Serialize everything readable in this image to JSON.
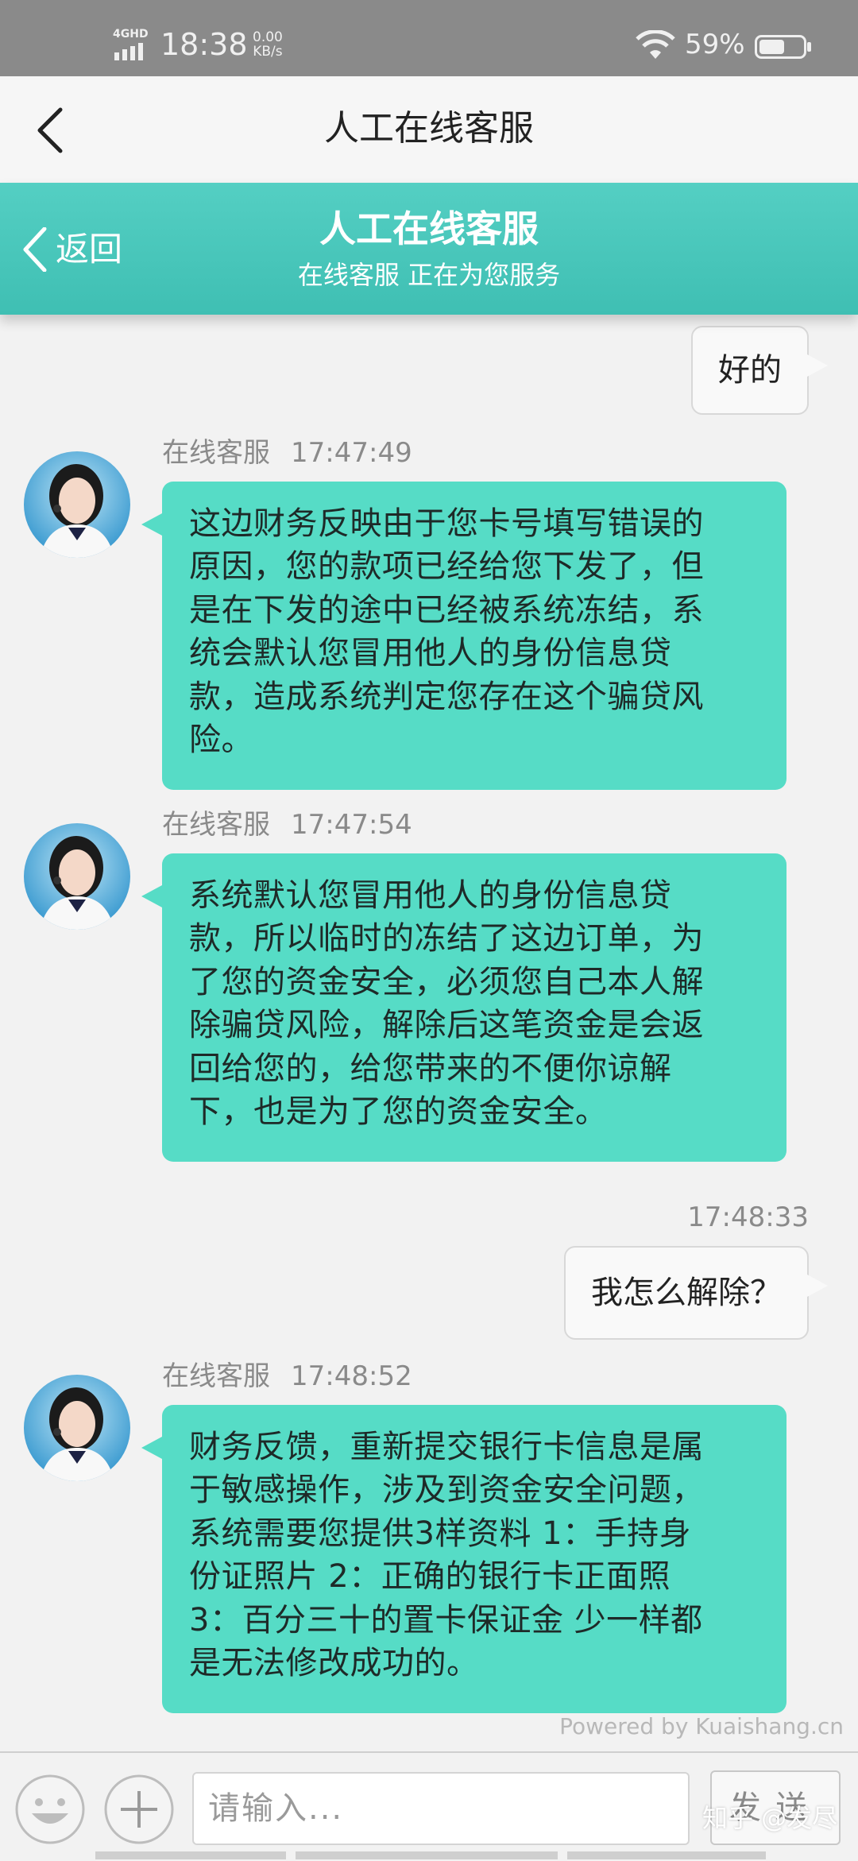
{
  "status_bar": {
    "network": "4GHD",
    "time": "18:38",
    "speed_value": "0.00",
    "speed_unit": "KB/s",
    "battery_percent": "59%",
    "battery_level": 0.59
  },
  "top_nav": {
    "back_icon": "chevron-left-icon",
    "title": "人工在线客服"
  },
  "chat_header": {
    "back_label": "返回",
    "title": "人工在线客服",
    "subtitle": "在线客服 正在为您服务"
  },
  "messages": [
    {
      "direction": "out",
      "text": "好的"
    },
    {
      "direction": "in",
      "sender": "在线客服",
      "time": "17:47:49",
      "lines": [
        "这边财务反映由于您卡号填写错误的",
        "原因，您的款项已经给您下发了，但",
        "是在下发的途中已经被系统冻结，系",
        "统会默认您冒用他人的身份信息贷",
        "款，造成系统判定您存在这个骗贷风",
        "险。"
      ]
    },
    {
      "direction": "in",
      "sender": "在线客服",
      "time": "17:47:54",
      "lines": [
        "系统默认您冒用他人的身份信息贷",
        "款，所以临时的冻结了这边订单，为",
        "了您的资金安全，必须您自己本人解",
        "除骗贷风险，解除后这笔资金是会返",
        "回给您的，给您带来的不便你谅解",
        "下，也是为了您的资金安全。"
      ]
    },
    {
      "direction": "out",
      "time": "17:48:33",
      "text": "我怎么解除？"
    },
    {
      "direction": "in",
      "sender": "在线客服",
      "time": "17:48:52",
      "lines": [
        "财务反馈，重新提交银行卡信息是属",
        "于敏感操作，涉及到资金安全问题，",
        "系统需要您提供3样资料 1：手持身",
        "份证照片 2：正确的银行卡正面照",
        "3：百分三十的置卡保证金 少一样都",
        "是无法修改成功的。"
      ]
    }
  ],
  "powered_by": "Powered by Kuaishang.cn",
  "input_bar": {
    "emoji_icon": "smiley-icon",
    "plus_icon": "plus-icon",
    "placeholder": "请输入...",
    "send_label": "发送"
  },
  "watermark": "知乎 @发尽",
  "colors": {
    "accent": "#4cc9bd",
    "incoming_bubble": "#56dcc6",
    "status_bar": "#8a8a8a"
  }
}
